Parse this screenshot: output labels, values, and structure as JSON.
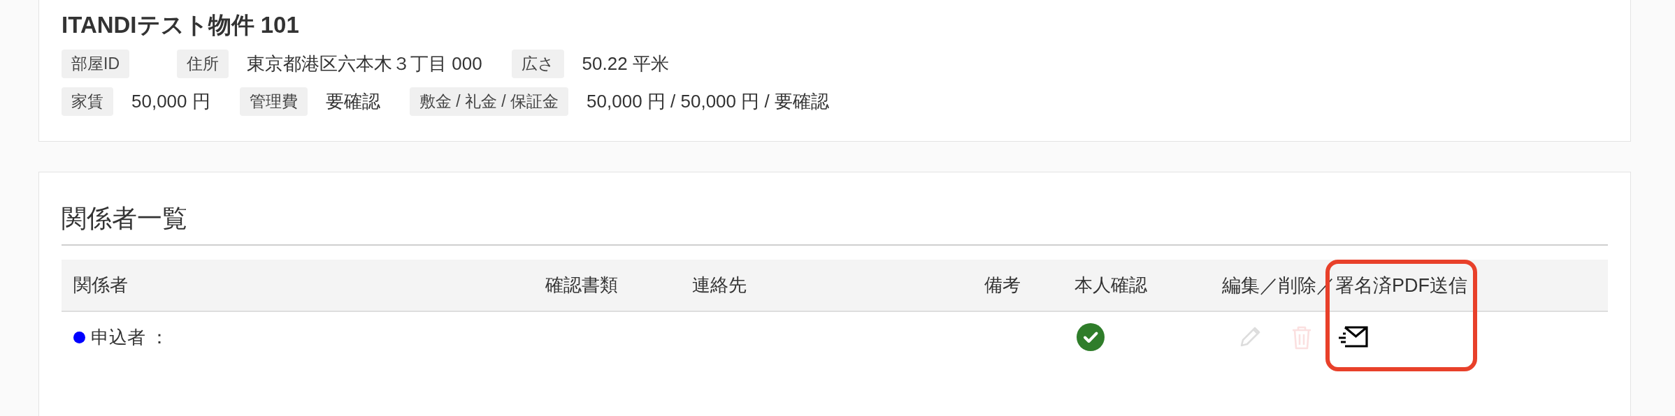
{
  "property": {
    "title": "ITANDIテスト物件 101",
    "detail_rows": [
      [
        {
          "label": "部屋ID"
        },
        {
          "label": "住所",
          "value": "東京都港区六本木３丁目 000"
        },
        {
          "label": "広さ",
          "value": "50.22 平米"
        }
      ],
      [
        {
          "label": "家賃",
          "value": "50,000 円"
        },
        {
          "label": "管理費",
          "value": "要確認"
        },
        {
          "label": "敷金 / 礼金 / 保証金",
          "value": "50,000 円 / 50,000 円 / 要確認"
        }
      ]
    ]
  },
  "parties": {
    "title": "関係者一覧",
    "columns": [
      "関係者",
      "確認書類",
      "連絡先",
      "備考",
      "本人確認",
      "編集／削除／署名済PDF送信"
    ],
    "rows": [
      {
        "color": "#0000ff",
        "name": "申込者 ：",
        "identity_verified": true,
        "edit_disabled": true,
        "delete_disabled": true
      }
    ]
  }
}
